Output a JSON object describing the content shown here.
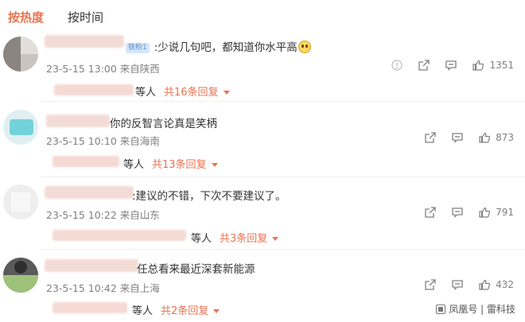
{
  "tabs": [
    {
      "label": "按热度",
      "active": true
    },
    {
      "label": "按时间",
      "active": false
    }
  ],
  "comments": [
    {
      "badge": "铁粉1",
      "text": ":少说几句吧，都知道你水平高",
      "date": "23-5-15 13:00",
      "location": "来自陕西",
      "likes": "1351",
      "reply_suffix": "等人",
      "reply_count": "共16条回复"
    },
    {
      "text": "你的反智言论真是笑柄",
      "date": "23-5-15 10:10",
      "location": "来自海南",
      "likes": "873",
      "reply_suffix": "等人",
      "reply_count": "共13条回复"
    },
    {
      "text": ":建议的不错，下次不要建议了。",
      "date": "23-5-15 10:22",
      "location": "来自山东",
      "likes": "791",
      "reply_suffix": "等人",
      "reply_count": "共3条回复"
    },
    {
      "text": "任总看来最近深套新能源",
      "date": "23-5-15 10:42",
      "location": "来自上海",
      "likes": "432",
      "reply_suffix": "等人",
      "reply_count": "共2条回复"
    }
  ],
  "watermark": "凤凰号 | 雷科技",
  "colors": {
    "accent": "#eb7350",
    "muted": "#808080",
    "text": "#333333"
  }
}
